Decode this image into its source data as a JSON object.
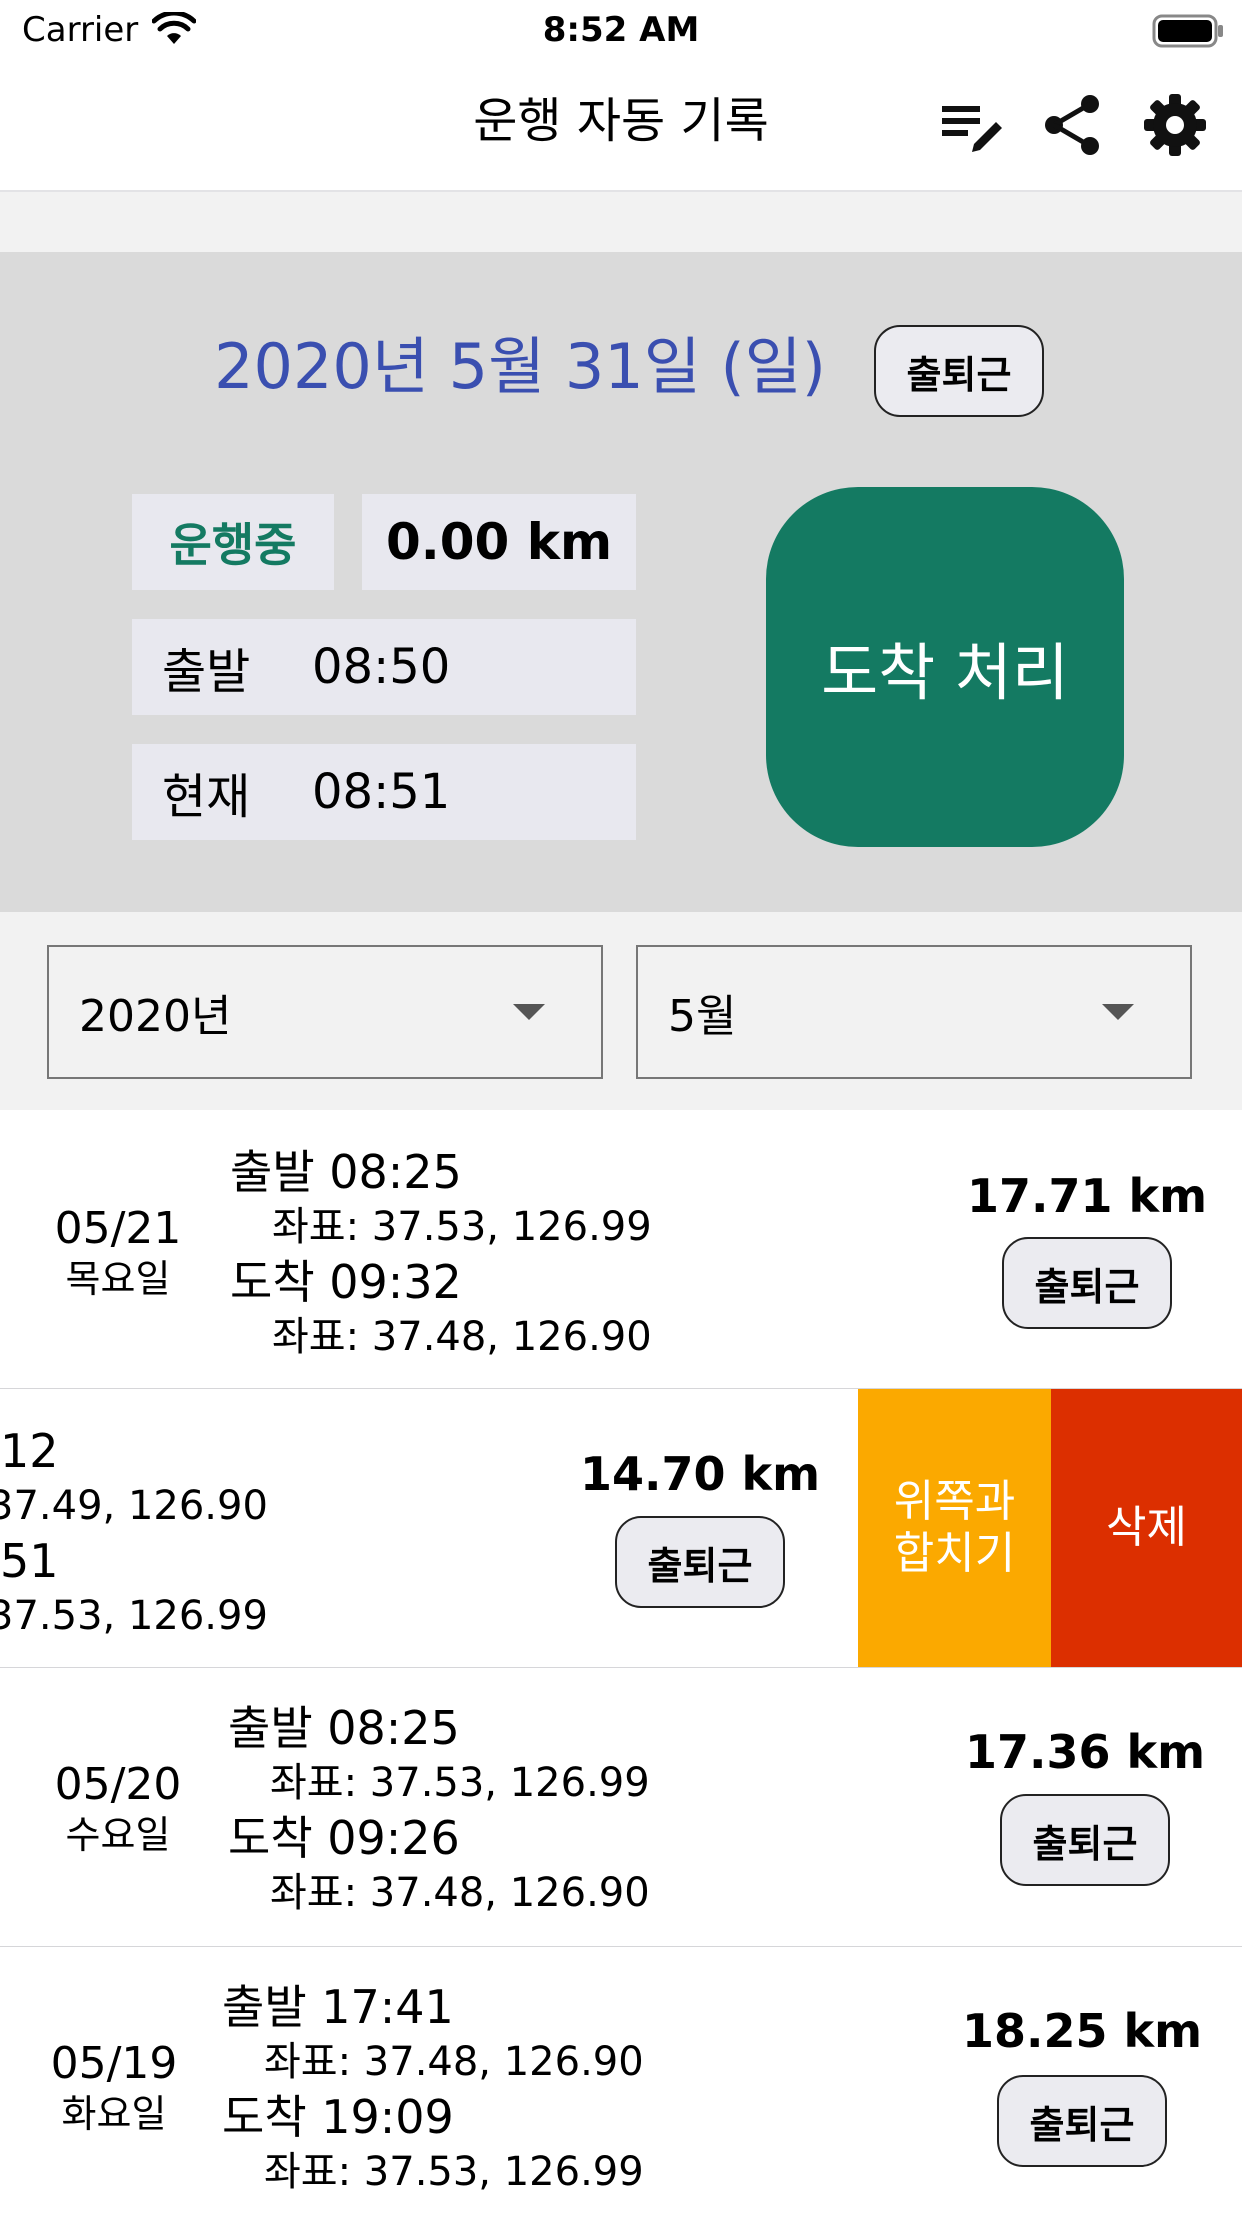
{
  "status_bar": {
    "carrier": "Carrier",
    "time": "8:52 AM",
    "icons": [
      "wifi-icon",
      "battery-icon"
    ]
  },
  "nav": {
    "title": "운행 자동 기록",
    "icons": [
      "edit-list-icon",
      "share-icon",
      "gear-icon"
    ]
  },
  "current_trip": {
    "date": "2020년 5월 31일 (일)",
    "tag_label": "출퇴근",
    "status": "운행중",
    "distance": "0.00 km",
    "depart_label": "출발",
    "depart_time": "08:50",
    "now_label": "현재",
    "now_time": "08:51",
    "arrive_button": "도착 처리"
  },
  "filters": {
    "year": "2020년",
    "month": "5월"
  },
  "trips": [
    {
      "date": "05/21",
      "weekday": "목요일",
      "depart": "출발 08:25",
      "depart_coord": "좌표: 37.53, 126.99",
      "arrive": "도착 09:32",
      "arrive_coord": "좌표: 37.48, 126.90",
      "distance": "17.71 km",
      "tag": "출퇴근"
    },
    {
      "depart": "12",
      "depart_coord": "37.49, 126.90",
      "arrive": "51",
      "arrive_coord": "37.53, 126.99",
      "distance": "14.70 km",
      "tag": "출퇴근",
      "merge_action": "위쪽과 합치기",
      "delete_action": "삭제"
    },
    {
      "date": "05/20",
      "weekday": "수요일",
      "depart": "출발 08:25",
      "depart_coord": "좌표: 37.53, 126.99",
      "arrive": "도착 09:26",
      "arrive_coord": "좌표: 37.48, 126.90",
      "distance": "17.36 km",
      "tag": "출퇴근"
    },
    {
      "date": "05/19",
      "weekday": "화요일",
      "depart": "출발 17:41",
      "depart_coord": "좌표: 37.48, 126.90",
      "arrive": "도착 19:09",
      "arrive_coord": "좌표: 37.53, 126.99",
      "distance": "18.25 km",
      "tag": "출퇴근"
    }
  ],
  "colors": {
    "accent_green": "#147a62",
    "date_blue": "#3a4fb0",
    "merge_orange": "#fba900",
    "delete_red": "#dc2f00"
  }
}
